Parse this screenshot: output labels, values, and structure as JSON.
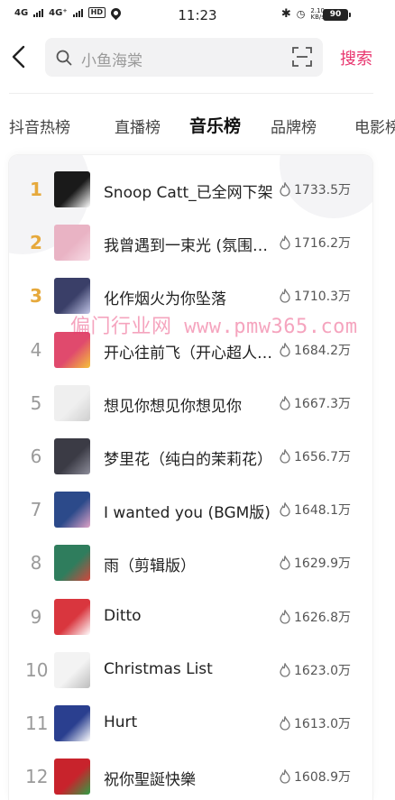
{
  "status_bar": {
    "signal1": "4G",
    "signal2": "4G⁺",
    "hd": "HD",
    "time": "11:23",
    "speed_value": "2.10",
    "speed_unit": "KB/s",
    "battery": "90"
  },
  "search": {
    "query": "小鱼海棠",
    "button_label": "搜索"
  },
  "tabs": [
    "抖音热榜",
    "直播榜",
    "音乐榜",
    "品牌榜",
    "电影榜"
  ],
  "active_tab": "音乐榜",
  "list": [
    {
      "rank": "1",
      "title": "Snoop Catt_已全网下架",
      "heat": "1733.5万",
      "cover": "#1a1a1a",
      "cover2": "#ffffff"
    },
    {
      "rank": "2",
      "title": "我曾遇到一束光 (氛围版)",
      "heat": "1716.2万",
      "cover": "#e9b3c4",
      "cover2": "#f7dce5"
    },
    {
      "rank": "3",
      "title": "化作烟火为你坠落",
      "heat": "1710.3万",
      "cover": "#3a3f68",
      "cover2": "#c0c4e6"
    },
    {
      "rank": "4",
      "title": "开心往前飞（开心超人联盟主题曲）",
      "heat": "1684.2万",
      "cover": "#e04a6d",
      "cover2": "#f5c23a"
    },
    {
      "rank": "5",
      "title": "想见你想见你想见你",
      "heat": "1667.3万",
      "cover": "#efefef",
      "cover2": "#cfcfcf"
    },
    {
      "rank": "6",
      "title": "梦里花（纯白的茉莉花）",
      "heat": "1656.7万",
      "cover": "#3b3b45",
      "cover2": "#8d8d9a"
    },
    {
      "rank": "7",
      "title": "I wanted you (BGM版)",
      "heat": "1648.1万",
      "cover": "#2c4a8a",
      "cover2": "#e0a3c8"
    },
    {
      "rank": "8",
      "title": "雨（剪辑版）",
      "heat": "1629.9万",
      "cover": "#2f7d5d",
      "cover2": "#d4463c"
    },
    {
      "rank": "9",
      "title": "Ditto",
      "heat": "1626.8万",
      "cover": "#d9363e",
      "cover2": "#ffffff"
    },
    {
      "rank": "10",
      "title": "Christmas List",
      "heat": "1623.0万",
      "cover": "#f3f3f3",
      "cover2": "#bdbdbd"
    },
    {
      "rank": "11",
      "title": "Hurt",
      "heat": "1613.0万",
      "cover": "#2a3f8f",
      "cover2": "#ffffff"
    },
    {
      "rank": "12",
      "title": "祝你聖誕快樂",
      "heat": "1608.9万",
      "cover": "#c8232c",
      "cover2": "#2f9e44"
    }
  ],
  "watermark": "偏门行业网 www.pmw365.com",
  "colors": {
    "accent": "#e8366f",
    "rank_top": "#e6a93c",
    "rank_other": "#9a9a9a"
  }
}
